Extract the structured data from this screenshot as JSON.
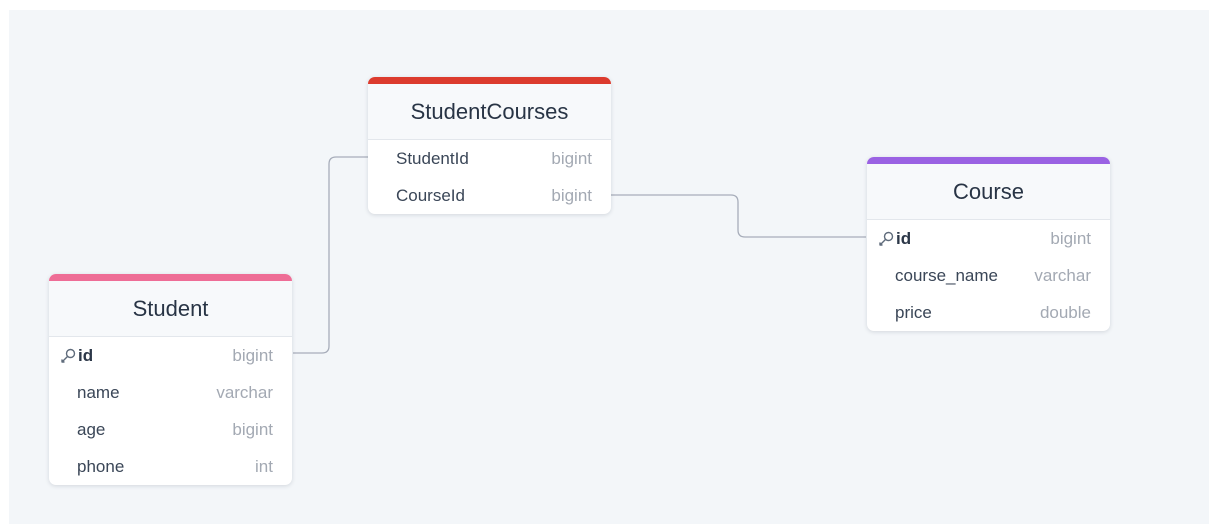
{
  "colors": {
    "canvas": "#f3f6f9",
    "connector": "#a7adba",
    "student_accent": "#ee6d96",
    "studentcourses_accent": "#dc3b2e",
    "course_accent": "#9a62e3"
  },
  "tables": {
    "student": {
      "name": "Student",
      "columns": [
        {
          "name": "id",
          "type": "bigint",
          "primary_key": true,
          "icon": "key-icon"
        },
        {
          "name": "name",
          "type": "varchar"
        },
        {
          "name": "age",
          "type": "bigint"
        },
        {
          "name": "phone",
          "type": "int"
        }
      ]
    },
    "student_courses": {
      "name": "StudentCourses",
      "columns": [
        {
          "name": "StudentId",
          "type": "bigint"
        },
        {
          "name": "CourseId",
          "type": "bigint"
        }
      ]
    },
    "course": {
      "name": "Course",
      "columns": [
        {
          "name": "id",
          "type": "bigint",
          "primary_key": true,
          "icon": "key-icon"
        },
        {
          "name": "course_name",
          "type": "varchar"
        },
        {
          "name": "price",
          "type": "double"
        }
      ]
    }
  },
  "relationships": [
    {
      "from": "StudentCourses.StudentId",
      "to": "Student.id"
    },
    {
      "from": "StudentCourses.CourseId",
      "to": "Course.id"
    }
  ]
}
